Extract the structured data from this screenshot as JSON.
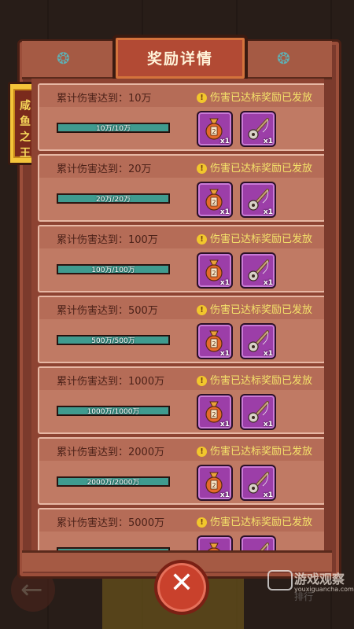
{
  "dialog": {
    "title": "奖励详情",
    "side_label": "咸鱼之王"
  },
  "items": [
    {
      "requirement": "累计伤害达到：10万",
      "status": "伤害已达标奖励已发放",
      "progress_text": "10万/10万",
      "progress": 1.0,
      "rewards": [
        {
          "icon": "gold-bag-icon",
          "count": "x1"
        },
        {
          "icon": "fishing-rod-icon",
          "count": "x1"
        }
      ]
    },
    {
      "requirement": "累计伤害达到：20万",
      "status": "伤害已达标奖励已发放",
      "progress_text": "20万/20万",
      "progress": 1.0,
      "rewards": [
        {
          "icon": "gold-bag-icon",
          "count": "x1"
        },
        {
          "icon": "fishing-rod-icon",
          "count": "x1"
        }
      ]
    },
    {
      "requirement": "累计伤害达到：100万",
      "status": "伤害已达标奖励已发放",
      "progress_text": "100万/100万",
      "progress": 1.0,
      "rewards": [
        {
          "icon": "gold-bag-icon",
          "count": "x1"
        },
        {
          "icon": "fishing-rod-icon",
          "count": "x1"
        }
      ]
    },
    {
      "requirement": "累计伤害达到：500万",
      "status": "伤害已达标奖励已发放",
      "progress_text": "500万/500万",
      "progress": 1.0,
      "rewards": [
        {
          "icon": "gold-bag-icon",
          "count": "x1"
        },
        {
          "icon": "fishing-rod-icon",
          "count": "x1"
        }
      ]
    },
    {
      "requirement": "累计伤害达到：1000万",
      "status": "伤害已达标奖励已发放",
      "progress_text": "1000万/1000万",
      "progress": 1.0,
      "rewards": [
        {
          "icon": "gold-bag-icon",
          "count": "x1"
        },
        {
          "icon": "fishing-rod-icon",
          "count": "x1"
        }
      ]
    },
    {
      "requirement": "累计伤害达到：2000万",
      "status": "伤害已达标奖励已发放",
      "progress_text": "2000万/2000万",
      "progress": 1.0,
      "rewards": [
        {
          "icon": "gold-bag-icon",
          "count": "x1"
        },
        {
          "icon": "fishing-rod-icon",
          "count": "x1"
        }
      ]
    },
    {
      "requirement": "累计伤害达到：5000万",
      "status": "伤害已达标奖励已发放",
      "progress_text": "",
      "progress": 1.0,
      "rewards": [
        {
          "icon": "gold-bag-icon",
          "count": ""
        },
        {
          "icon": "fishing-rod-icon",
          "count": ""
        }
      ]
    }
  ],
  "background": {
    "rank_label": "排行"
  },
  "watermark": {
    "name": "游戏观察",
    "url": "youxiguancha.com"
  },
  "colors": {
    "accent_teal": "#3f9b8f",
    "status_yellow": "#f5e36a",
    "reward_purple": "#9c3ea8",
    "close_red": "#c9412c"
  }
}
